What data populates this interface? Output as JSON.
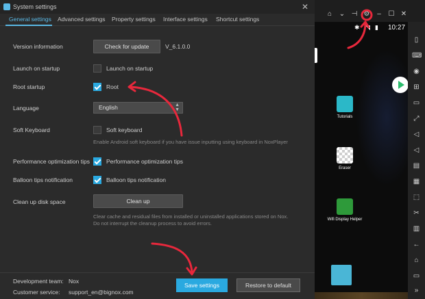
{
  "dialog": {
    "title": "System settings",
    "close_glyph": "✕",
    "tabs": [
      {
        "label": "General settings"
      },
      {
        "label": "Advanced settings"
      },
      {
        "label": "Property settings"
      },
      {
        "label": "Interface settings"
      },
      {
        "label": "Shortcut settings"
      }
    ],
    "version": {
      "label": "Version information",
      "button": "Check for update",
      "value": "V_6.1.0.0"
    },
    "launch_startup": {
      "label": "Launch on startup",
      "checkbox_label": "Launch on startup",
      "checked": false
    },
    "root_startup": {
      "label": "Root startup",
      "checkbox_label": "Root",
      "checked": true
    },
    "language": {
      "label": "Language",
      "value": "English"
    },
    "soft_keyboard": {
      "label": "Soft Keyboard",
      "checkbox_label": "Soft keyboard",
      "checked": false,
      "hint": "Enable Android soft keyboard if you have issue inputting using keyboard in NoxPlayer"
    },
    "perf_tips": {
      "label": "Performance optimization tips",
      "checkbox_label": "Performance optimization tips",
      "checked": true
    },
    "balloon_tips": {
      "label": "Balloon tips notification",
      "checkbox_label": "Balloon tips notification",
      "checked": true
    },
    "cleanup": {
      "label": "Clean up disk space",
      "button": "Clean up",
      "hint": "Clear cache and residual files from installed or uninstalled applications stored on Nox. Do not interrupt the cleanup process to avoid errors."
    },
    "footer": {
      "dev_team_label": "Development team:",
      "dev_team_value": "Nox",
      "support_label": "Customer service:",
      "support_value": "support_en@bignox.com",
      "save_button": "Save settings",
      "restore_button": "Restore to default"
    }
  },
  "emulator": {
    "status_time": "10:27",
    "apps": [
      {
        "label": "Tutorials",
        "color": "#2bb8c8"
      },
      {
        "label": "Eraser",
        "color": "#e8e8e8"
      },
      {
        "label": "Wifi Display Helper",
        "color": "#2e9a3a"
      }
    ],
    "accent": "#2aa9e0",
    "annotation_color": "#e8283c"
  }
}
